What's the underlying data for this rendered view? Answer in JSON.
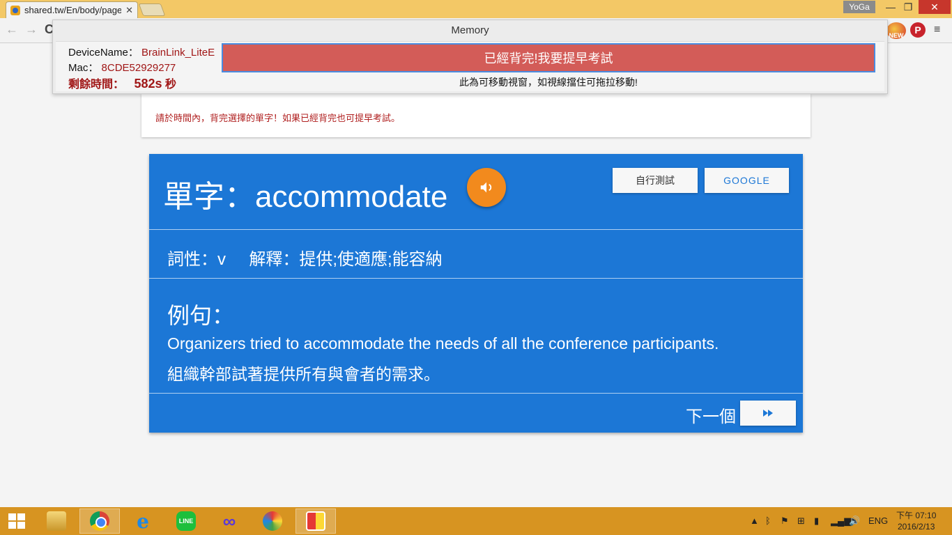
{
  "browser": {
    "tab_title": "shared.tw/En/body/page",
    "tab_close": "✕",
    "profile_name": "YoGa",
    "window_controls": {
      "minimize": "—",
      "maximize": "❐",
      "close": "✕"
    },
    "nav": {
      "back": "←",
      "forward": "→",
      "reload": "C"
    },
    "extensions": {
      "new_badge": "NEW",
      "pinterest": "P"
    },
    "menu": "≡"
  },
  "popup": {
    "title": "Memory",
    "device_label": "DeviceName：",
    "device_value": "BrainLink_LiteE",
    "mac_label": "Mac：",
    "mac_value": "8CDE52929277",
    "remaining_label": "剩餘時間：",
    "remaining_value": "582s",
    "remaining_unit": "秒",
    "early_exam_button": "已經背完!我要提早考試",
    "drag_hint": "此為可移動視窗，如視線擋住可拖拉移動!"
  },
  "notice": {
    "text": "請於時間內，背完選擇的單字！如果已經背完也可提早考試。"
  },
  "card": {
    "word_prefix": "單字：",
    "word": "accommodate",
    "self_test_button": "自行測試",
    "google_button": "GOOGLE",
    "pos_label": "詞性：",
    "pos_value": "v",
    "meaning_label": "解釋：",
    "meaning_value": "提供;使適應;能容納",
    "example_title": "例句：",
    "example_en": "Organizers tried to accommodate the needs of all the conference participants.",
    "example_zh": "組織幹部試著提供所有與會者的需求。",
    "next_label": "下一個",
    "next_button_icon": "fast-forward-icon"
  },
  "taskbar": {
    "apps": [
      "file-explorer",
      "chrome",
      "internet-explorer",
      "line",
      "infinity-app",
      "paint",
      "tile-app"
    ],
    "language": "ENG",
    "time": "下午 07:10",
    "date": "2016/2/13"
  },
  "colors": {
    "card_blue": "#1c77d6",
    "sound_orange": "#f28a1d",
    "early_button_red": "#d35c58",
    "alert_red": "#a01616",
    "taskbar": "#d79421",
    "titlebar": "#f3c866"
  }
}
